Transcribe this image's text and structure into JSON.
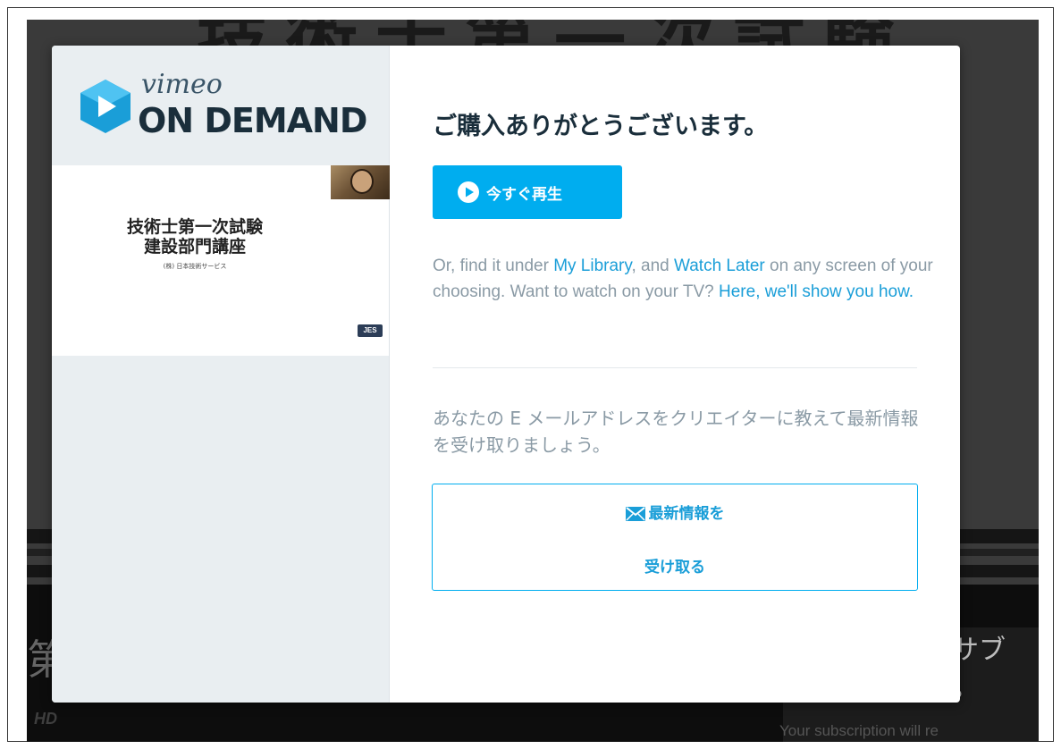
{
  "background": {
    "title_partial": "技術士第一次試験",
    "left_char": "第",
    "hd_badge": "HD",
    "right_text_1": "はサブ",
    "right_text_2": "です。",
    "right_text_3": "Your subscription will re"
  },
  "brand": {
    "vimeo": "vimeo",
    "on_demand": "ON DEMAND"
  },
  "cover": {
    "title_line_1": "技術士第一次試験",
    "title_line_2": "建設部門講座",
    "publisher": "(株) 日本技術サービス",
    "logo": "JES"
  },
  "modal": {
    "heading": "ご購入ありがとうございます。",
    "play_button": "今すぐ再生",
    "desc": {
      "part1": "Or, find it under ",
      "link_library": "My Library",
      "part2": ", and ",
      "link_watch_later": "Watch Later",
      "part3": " on any screen of your choosing. Want to watch on your TV? ",
      "link_here": "Here, we'll show you how."
    },
    "email_prompt": "あなたの E メールアドレスをクリエイターに教えて最新情報を受け取りましょう。",
    "optin_line_1": "最新情報を",
    "optin_line_2": "受け取る"
  },
  "colors": {
    "accent": "#00adef",
    "link": "#1a9ed8",
    "heading": "#1a2e3b",
    "muted_text": "#8a9aa5"
  }
}
